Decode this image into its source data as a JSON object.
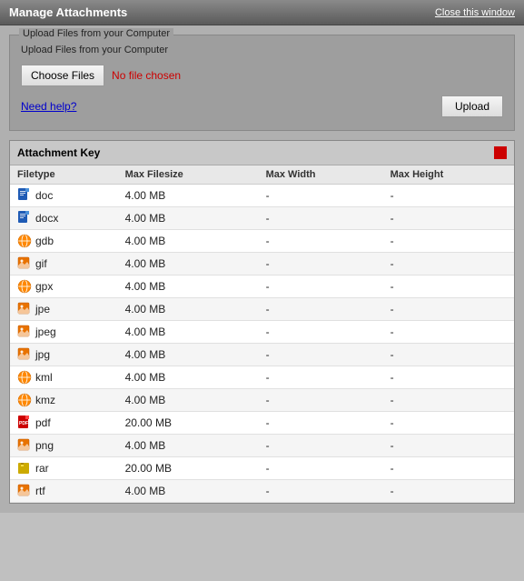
{
  "header": {
    "title": "Manage Attachments",
    "close_label": "Close this window"
  },
  "upload_section": {
    "legend": "Upload Files from your Computer",
    "choose_files_label": "Choose Files",
    "no_file_text": "No file chosen",
    "help_link_label": "Need help?",
    "upload_btn_label": "Upload"
  },
  "attachment_key": {
    "title": "Attachment Key",
    "columns": [
      "Filetype",
      "Max Filesize",
      "Max Width",
      "Max Height"
    ],
    "rows": [
      {
        "type": "doc",
        "icon": "doc",
        "max_size": "4.00 MB",
        "max_width": "-",
        "max_height": "-"
      },
      {
        "type": "docx",
        "icon": "doc",
        "max_size": "4.00 MB",
        "max_width": "-",
        "max_height": "-"
      },
      {
        "type": "gdb",
        "icon": "globe",
        "max_size": "4.00 MB",
        "max_width": "-",
        "max_height": "-"
      },
      {
        "type": "gif",
        "icon": "image",
        "max_size": "4.00 MB",
        "max_width": "-",
        "max_height": "-"
      },
      {
        "type": "gpx",
        "icon": "globe",
        "max_size": "4.00 MB",
        "max_width": "-",
        "max_height": "-"
      },
      {
        "type": "jpe",
        "icon": "image",
        "max_size": "4.00 MB",
        "max_width": "-",
        "max_height": "-"
      },
      {
        "type": "jpeg",
        "icon": "image",
        "max_size": "4.00 MB",
        "max_width": "-",
        "max_height": "-"
      },
      {
        "type": "jpg",
        "icon": "image",
        "max_size": "4.00 MB",
        "max_width": "-",
        "max_height": "-"
      },
      {
        "type": "kml",
        "icon": "globe",
        "max_size": "4.00 MB",
        "max_width": "-",
        "max_height": "-"
      },
      {
        "type": "kmz",
        "icon": "globe",
        "max_size": "4.00 MB",
        "max_width": "-",
        "max_height": "-"
      },
      {
        "type": "pdf",
        "icon": "pdf",
        "max_size": "20.00 MB",
        "max_width": "-",
        "max_height": "-"
      },
      {
        "type": "png",
        "icon": "image",
        "max_size": "4.00 MB",
        "max_width": "-",
        "max_height": "-"
      },
      {
        "type": "rar",
        "icon": "rar",
        "max_size": "20.00 MB",
        "max_width": "-",
        "max_height": "-"
      },
      {
        "type": "rtf",
        "icon": "image",
        "max_size": "4.00 MB",
        "max_width": "-",
        "max_height": "-"
      }
    ]
  }
}
